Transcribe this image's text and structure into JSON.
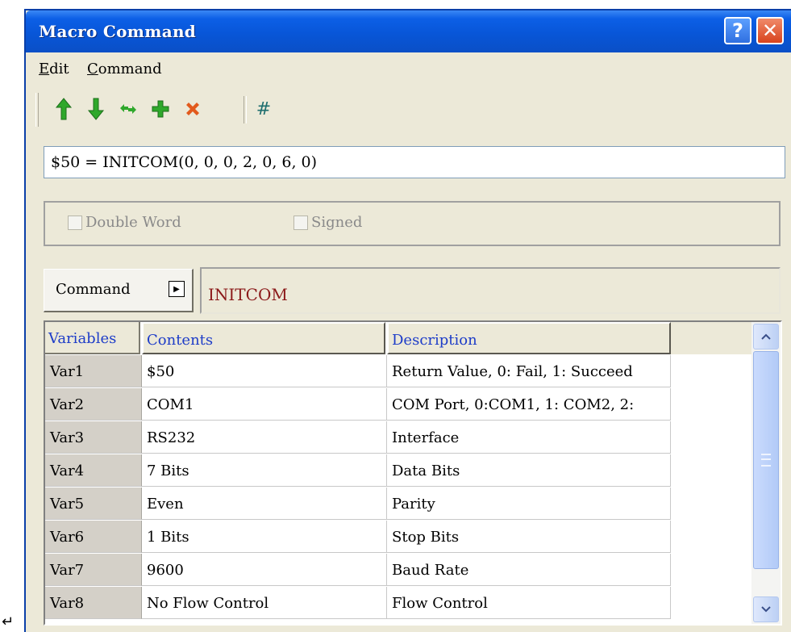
{
  "window": {
    "title": "Macro Command",
    "help_label": "?",
    "close_label": "✕"
  },
  "menu": [
    {
      "label": "Edit",
      "mnemonic": "E",
      "rest": "dit"
    },
    {
      "label": "Command",
      "mnemonic": "C",
      "rest": "ommand"
    }
  ],
  "toolbar": {
    "icons": [
      "up-arrow-icon",
      "down-arrow-icon",
      "replace-icon",
      "add-icon",
      "delete-icon",
      "hash-icon"
    ],
    "colors": {
      "green": "#2fa82b",
      "red": "#e25a1c",
      "teal": "#1e6e6e"
    },
    "hash_label": "#"
  },
  "expression": {
    "value": "$50 = INITCOM(0, 0, 0, 2, 0, 6, 0)"
  },
  "options": {
    "double_word_label": "Double Word",
    "signed_label": "Signed"
  },
  "command": {
    "button_label": "Command",
    "value": "INITCOM"
  },
  "grid": {
    "headers": {
      "variables": "Variables",
      "contents": "Contents",
      "description": "Description"
    },
    "rows": [
      {
        "var": "Var1",
        "contents": "$50",
        "description": "Return Value, 0: Fail, 1: Succeed"
      },
      {
        "var": "Var2",
        "contents": "COM1",
        "description": "COM Port, 0:COM1, 1: COM2, 2:"
      },
      {
        "var": "Var3",
        "contents": "RS232",
        "description": "Interface"
      },
      {
        "var": "Var4",
        "contents": "7 Bits",
        "description": "Data Bits"
      },
      {
        "var": "Var5",
        "contents": "Even",
        "description": "Parity"
      },
      {
        "var": "Var6",
        "contents": "1 Bits",
        "description": "Stop Bits"
      },
      {
        "var": "Var7",
        "contents": "9600",
        "description": "Baud Rate"
      },
      {
        "var": "Var8",
        "contents": "No Flow Control",
        "description": "Flow Control"
      }
    ]
  },
  "corner_mark": "↵"
}
